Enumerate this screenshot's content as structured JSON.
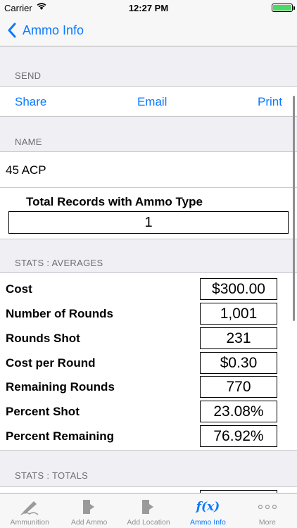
{
  "status_bar": {
    "carrier": "Carrier",
    "time": "12:27 PM"
  },
  "nav": {
    "back_label": "Ammo Info"
  },
  "send": {
    "header": "SEND",
    "share": "Share",
    "email": "Email",
    "print": "Print"
  },
  "name": {
    "header": "NAME",
    "value": "45 ACP",
    "total_label": "Total Records with Ammo Type",
    "total_value": "1"
  },
  "averages": {
    "header": "STATS : AVERAGES",
    "rows": [
      {
        "label": "Cost",
        "value": "$300.00"
      },
      {
        "label": "Number of Rounds",
        "value": "1,001"
      },
      {
        "label": "Rounds Shot",
        "value": "231"
      },
      {
        "label": "Cost per Round",
        "value": "$0.30"
      },
      {
        "label": "Remaining Rounds",
        "value": "770"
      },
      {
        "label": "Percent Shot",
        "value": "23.08%"
      },
      {
        "label": "Percent Remaining",
        "value": "76.92%"
      }
    ]
  },
  "totals": {
    "header": "STATS : TOTALS"
  },
  "tabs": [
    {
      "label": "Ammunition",
      "icon": "pen-icon"
    },
    {
      "label": "Add Ammo",
      "icon": "add-document-icon"
    },
    {
      "label": "Add Location",
      "icon": "add-document-icon"
    },
    {
      "label": "Ammo Info",
      "icon": "function-icon",
      "active": true
    },
    {
      "label": "More",
      "icon": "more-icon"
    }
  ],
  "colors": {
    "accent": "#0a7aff",
    "inactive_tab": "#929292",
    "battery": "#4cd964"
  }
}
